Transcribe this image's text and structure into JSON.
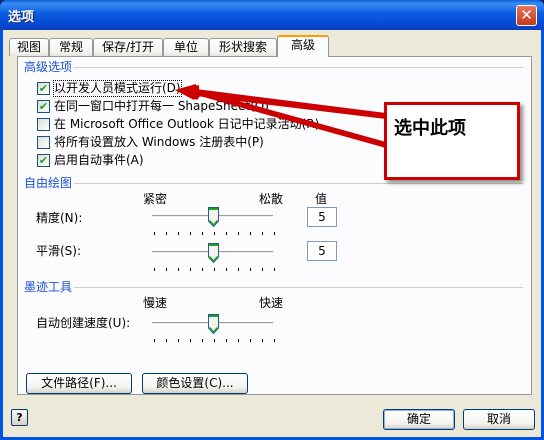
{
  "window": {
    "title": "选项",
    "close_symbol": "✕"
  },
  "tabs": [
    {
      "label": "视图",
      "active": false
    },
    {
      "label": "常规",
      "active": false
    },
    {
      "label": "保存/打开",
      "active": false
    },
    {
      "label": "单位",
      "active": false
    },
    {
      "label": "形状搜索",
      "active": false
    },
    {
      "label": "高级",
      "active": true
    }
  ],
  "advanced_options": {
    "title": "高级选项",
    "items": [
      {
        "label": "以开发人员模式运行(D)",
        "checked": true
      },
      {
        "label": "在同一窗口中打开每一 ShapeSheet(O)",
        "checked": true
      },
      {
        "label": "在 Microsoft Office Outlook 日记中记录活动(R)",
        "checked": false
      },
      {
        "label": "将所有设置放入 Windows 注册表中(P)",
        "checked": false
      },
      {
        "label": "启用自动事件(A)",
        "checked": true
      }
    ]
  },
  "freeform": {
    "title": "自由绘图",
    "left_label": "紧密",
    "right_label": "松散",
    "value_header": "值",
    "precision": {
      "label": "精度(N):",
      "value": "5",
      "level": 0.5
    },
    "smoothing": {
      "label": "平滑(S):",
      "value": "5",
      "level": 0.5
    }
  },
  "ink": {
    "title": "墨迹工具",
    "left_label": "慢速",
    "right_label": "快速",
    "auto_speed": {
      "label": "自动创建速度(U):",
      "level": 0.5
    }
  },
  "buttons": {
    "file_paths": "文件路径(F)...",
    "color_settings": "颜色设置(C)...",
    "help_symbol": "?",
    "ok": "确定",
    "cancel": "取消"
  },
  "annotation": {
    "text": "选中此项",
    "color": "#cc0000"
  },
  "colors": {
    "titlebar": "#0a5ce0",
    "group_title": "#1b4fd6",
    "active_tab_accent": "#ff9c00",
    "dialog_bg": "#ece9d8"
  }
}
